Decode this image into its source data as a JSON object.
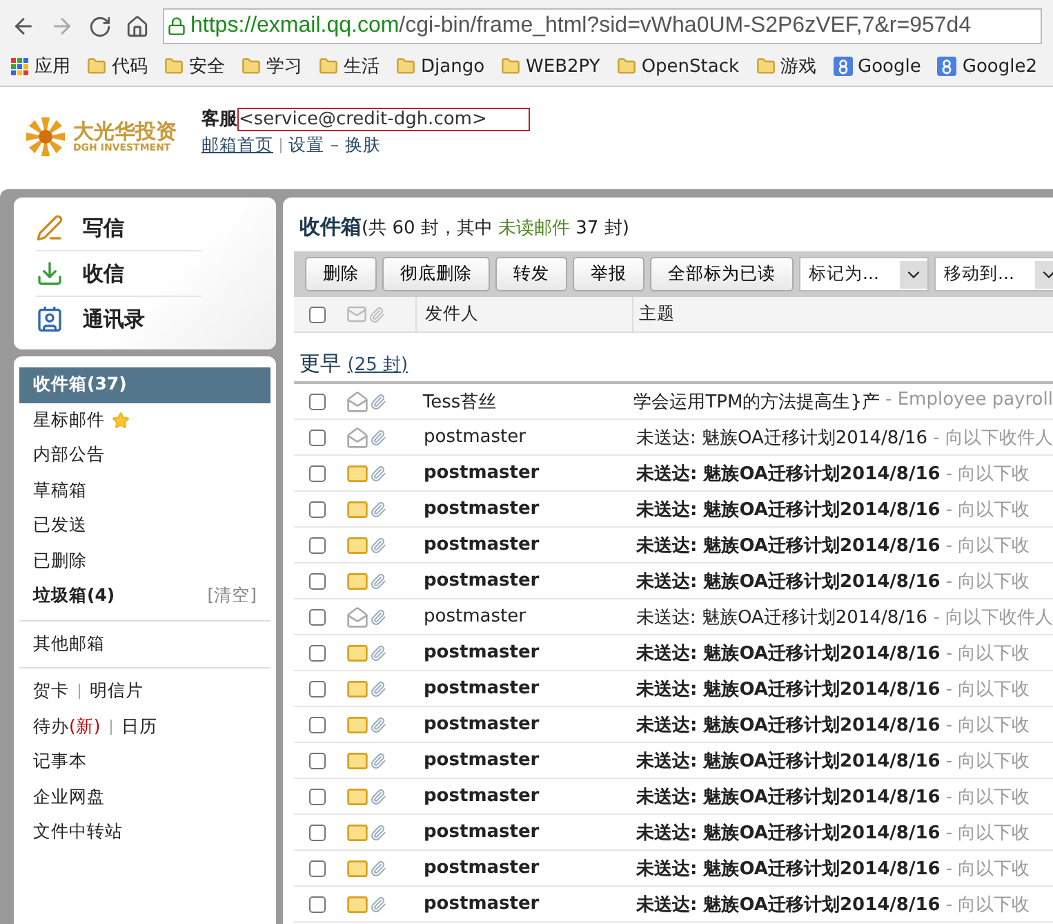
{
  "browser": {
    "url_host": "https://exmail.qq.com",
    "url_path": "/cgi-bin/frame_html?sid=vWha0UM-S2P6zVEF,7&r=957d4",
    "bookmarks": [
      {
        "kind": "apps",
        "label": "应用"
      },
      {
        "kind": "folder",
        "label": "代码"
      },
      {
        "kind": "folder",
        "label": "安全"
      },
      {
        "kind": "folder",
        "label": "学习"
      },
      {
        "kind": "folder",
        "label": "生活"
      },
      {
        "kind": "folder",
        "label": "Django"
      },
      {
        "kind": "folder",
        "label": "WEB2PY"
      },
      {
        "kind": "folder",
        "label": "OpenStack"
      },
      {
        "kind": "folder",
        "label": "游戏"
      },
      {
        "kind": "site",
        "label": "Google"
      },
      {
        "kind": "site",
        "label": "Google2"
      }
    ]
  },
  "header": {
    "logo_text": "大光华投资",
    "logo_subtext": "DGH INVESTMENT",
    "user_name": "客服",
    "user_email": "<service@credit-dgh.com>",
    "links": [
      {
        "label": "邮箱首页",
        "underline": true
      },
      {
        "label": "设置",
        "underline": false
      },
      {
        "label": "换肤",
        "underline": false
      }
    ]
  },
  "actions": [
    {
      "kind": "compose",
      "label": "写信"
    },
    {
      "kind": "receive",
      "label": "收信"
    },
    {
      "kind": "contacts",
      "label": "通讯录"
    }
  ],
  "folders": [
    {
      "label": "收件箱",
      "count": "(37)",
      "selected": true,
      "bold": true
    },
    {
      "label": "星标邮件",
      "selected": false,
      "bold": false,
      "star": true
    },
    {
      "label": "内部公告",
      "selected": false,
      "bold": false
    },
    {
      "label": "草稿箱",
      "selected": false,
      "bold": false
    },
    {
      "label": "已发送",
      "selected": false,
      "bold": false
    },
    {
      "label": "已删除",
      "selected": false,
      "bold": false
    },
    {
      "label": "垃圾箱",
      "count": "(4)",
      "selected": false,
      "bold": true,
      "action": "[清空]"
    }
  ],
  "other_mailbox": "其他邮箱",
  "tools": [
    [
      {
        "label": "贺卡"
      },
      {
        "label": "明信片"
      }
    ],
    [
      {
        "label": "待办",
        "badge": "(新)"
      },
      {
        "label": "日历"
      }
    ],
    [
      {
        "label": "记事本"
      }
    ],
    [
      {
        "label": "企业网盘"
      }
    ],
    [
      {
        "label": "文件中转站"
      }
    ]
  ],
  "inbox": {
    "title": "收件箱",
    "summary_before": "(共 60 封，其中 ",
    "unread_label": "未读邮件",
    "summary_after": " 37 封)",
    "buttons": [
      "删除",
      "彻底删除",
      "转发",
      "举报",
      "全部标为已读"
    ],
    "dropdowns": [
      "标记为...",
      "移动到..."
    ],
    "select_all_checked": false,
    "columns": [
      "发件人",
      "主题"
    ],
    "group": {
      "label": "更早",
      "count": "(25 封)"
    },
    "rows": [
      {
        "sender": "Tess苔丝",
        "subject": "学会运用TPM的方法提高生}产",
        "preview": "- Employee payroll",
        "unread": false
      },
      {
        "sender": "postmaster",
        "subject": "未送达: 魅族OA迁移计划2014/8/16",
        "preview": "- 向以下收件人",
        "unread": false
      },
      {
        "sender": "postmaster",
        "subject": "未送达: 魅族OA迁移计划2014/8/16",
        "preview": "- 向以下收",
        "unread": true
      },
      {
        "sender": "postmaster",
        "subject": "未送达: 魅族OA迁移计划2014/8/16",
        "preview": "- 向以下收",
        "unread": true
      },
      {
        "sender": "postmaster",
        "subject": "未送达: 魅族OA迁移计划2014/8/16",
        "preview": "- 向以下收",
        "unread": true
      },
      {
        "sender": "postmaster",
        "subject": "未送达: 魅族OA迁移计划2014/8/16",
        "preview": "- 向以下收",
        "unread": true
      },
      {
        "sender": "postmaster",
        "subject": "未送达: 魅族OA迁移计划2014/8/16",
        "preview": "- 向以下收件人",
        "unread": false
      },
      {
        "sender": "postmaster",
        "subject": "未送达: 魅族OA迁移计划2014/8/16",
        "preview": "- 向以下收",
        "unread": true
      },
      {
        "sender": "postmaster",
        "subject": "未送达: 魅族OA迁移计划2014/8/16",
        "preview": "- 向以下收",
        "unread": true
      },
      {
        "sender": "postmaster",
        "subject": "未送达: 魅族OA迁移计划2014/8/16",
        "preview": "- 向以下收",
        "unread": true
      },
      {
        "sender": "postmaster",
        "subject": "未送达: 魅族OA迁移计划2014/8/16",
        "preview": "- 向以下收",
        "unread": true
      },
      {
        "sender": "postmaster",
        "subject": "未送达: 魅族OA迁移计划2014/8/16",
        "preview": "- 向以下收",
        "unread": true
      },
      {
        "sender": "postmaster",
        "subject": "未送达: 魅族OA迁移计划2014/8/16",
        "preview": "- 向以下收",
        "unread": true
      },
      {
        "sender": "postmaster",
        "subject": "未送达: 魅族OA迁移计划2014/8/16",
        "preview": "- 向以下收",
        "unread": true
      },
      {
        "sender": "postmaster",
        "subject": "未送达: 魅族OA迁移计划2014/8/16",
        "preview": "- 向以下收",
        "unread": true
      }
    ]
  }
}
